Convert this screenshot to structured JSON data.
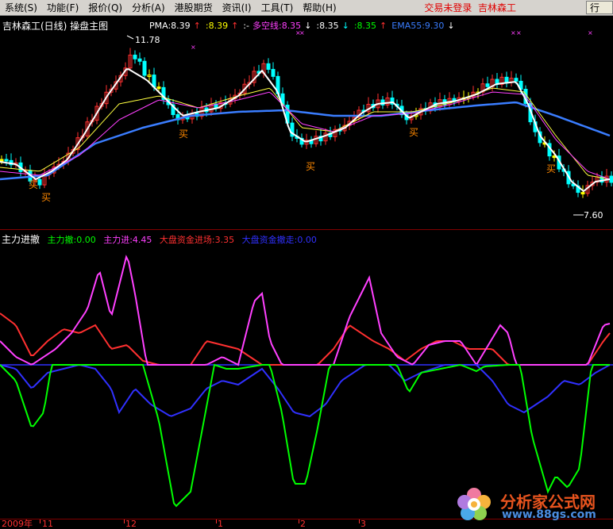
{
  "menubar": {
    "items": [
      "系统(S)",
      "功能(F)",
      "报价(Q)",
      "分析(A)",
      "港股期货",
      "资讯(I)",
      "工具(T)",
      "帮助(H)"
    ],
    "status_text": "交易未登录",
    "stock_name": "吉林森工",
    "close_label": "行"
  },
  "main_chart": {
    "title": "吉林森工(日线) 操盘主图",
    "indicators": [
      {
        "text": "PMA:8.39",
        "color": "#ffffff",
        "arrow": "↑",
        "arrow_color": "#ff3030"
      },
      {
        "text": ":8.39",
        "color": "#ffff00",
        "arrow": "↑",
        "arrow_color": "#ff3030"
      },
      {
        "text": ":-",
        "color": "#ffffff",
        "arrow": "",
        "arrow_color": ""
      },
      {
        "text": "多空线:8.35",
        "color": "#ff40ff",
        "arrow": "↓",
        "arrow_color": "#ffffff"
      },
      {
        "text": ":8.35",
        "color": "#ffffff",
        "arrow": "↓",
        "arrow_color": "#00ffff"
      },
      {
        "text": ":8.35",
        "color": "#00ff00",
        "arrow": "↑",
        "arrow_color": "#ff3030"
      },
      {
        "text": "EMA55:9.30",
        "color": "#3a7dff",
        "arrow": "↓",
        "arrow_color": "#ffffff"
      }
    ],
    "high_label": "11.78",
    "low_label": "7.60",
    "buy_label": "买",
    "colors": {
      "up": "#ff3030",
      "down": "#00ffff",
      "flat": "#ffff00",
      "ma_white": "#ffffff",
      "ma_yellow": "#ffff40",
      "ma_pink": "#ff40ff",
      "ema": "#3a7dff",
      "marker": "#ff40ff"
    }
  },
  "sub_chart": {
    "title": "主力进撤",
    "legend": [
      {
        "text": "主力撤:0.00",
        "color": "#00ff00"
      },
      {
        "text": "主力进:4.45",
        "color": "#ff40ff"
      },
      {
        "text": "大盘资金进场:3.35",
        "color": "#ff3030"
      },
      {
        "text": "大盘资金撤走:0.00",
        "color": "#3030ff"
      }
    ]
  },
  "date_axis": {
    "labels": [
      "2009年",
      "11",
      "12",
      "1",
      "2",
      "3"
    ]
  },
  "watermark": {
    "cn": "分析家公式网",
    "url": "www.88gs.com"
  }
}
